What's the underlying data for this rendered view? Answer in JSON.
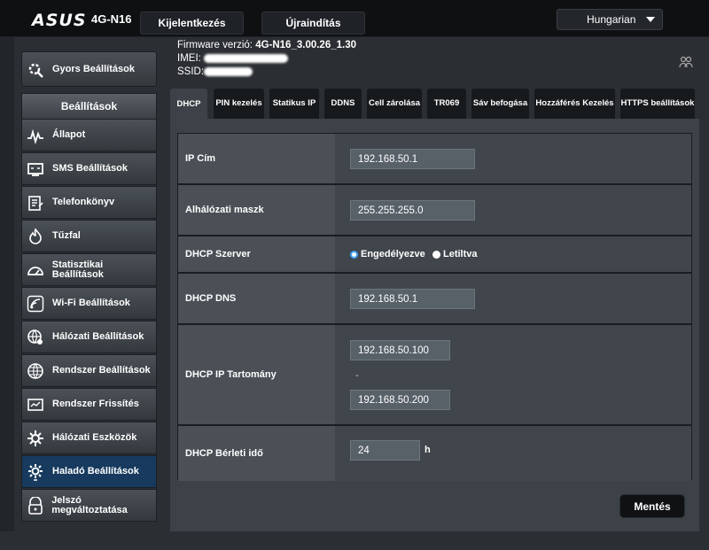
{
  "header": {
    "brand": "ASUS",
    "model": "4G-N16",
    "login": "Kijelentkezés",
    "reboot": "Újraindítás",
    "language": "Hungarian"
  },
  "info": {
    "firmware_label": "Firmware verzió:",
    "firmware_value": "4G-N16_3.00.26_1.30",
    "imei_label": "IMEI:",
    "ssid_label": "SSID:"
  },
  "sidebar": {
    "quick": "Gyors Beállítások",
    "settings_header": "Beállítások",
    "items": [
      {
        "label": "Állapot",
        "icon": "pulse-icon"
      },
      {
        "label": "SMS Beállítások",
        "icon": "sms-icon"
      },
      {
        "label": "Telefonkönyv",
        "icon": "phonebook-icon"
      },
      {
        "label": "Tűzfal",
        "icon": "firewall-icon"
      },
      {
        "label": "Statisztikai Beállítások",
        "icon": "gauge-icon"
      },
      {
        "label": "Wi-Fi Beállítások",
        "icon": "wifi-icon"
      },
      {
        "label": "Hálózati Beállítások",
        "icon": "globe-network-icon"
      },
      {
        "label": "Rendszer Beállítások",
        "icon": "globe-icon"
      },
      {
        "label": "Rendszer Frissítés",
        "icon": "router-update-icon"
      },
      {
        "label": "Hálózati Eszközök",
        "icon": "tools-icon"
      },
      {
        "label": "Haladó Beállítások",
        "icon": "advanced-gear-icon"
      },
      {
        "label": "Jelszó megváltoztatása",
        "icon": "lock-icon"
      }
    ]
  },
  "tabs": [
    "DHCP",
    "PIN kezelés",
    "Statikus IP",
    "DDNS",
    "Cell zárolása",
    "TR069",
    "Sáv befogása",
    "Hozzáférés Kezelés",
    "HTTPS beállítások"
  ],
  "form": {
    "ip_label": "IP Cím",
    "ip_value": "192.168.50.1",
    "mask_label": "Alhálózati maszk",
    "mask_value": "255.255.255.0",
    "dhcp_server_label": "DHCP Szerver",
    "enabled": "Engedélyezve",
    "disabled": "Letiltva",
    "dns_label": "DHCP DNS",
    "dns_value": "192.168.50.1",
    "range_label": "DHCP IP Tartomány",
    "range_start": "192.168.50.100",
    "range_sep": "-",
    "range_end": "192.168.50.200",
    "lease_label": "DHCP Bérleti idő",
    "lease_value": "24",
    "lease_unit": "h"
  },
  "save": "Mentés"
}
